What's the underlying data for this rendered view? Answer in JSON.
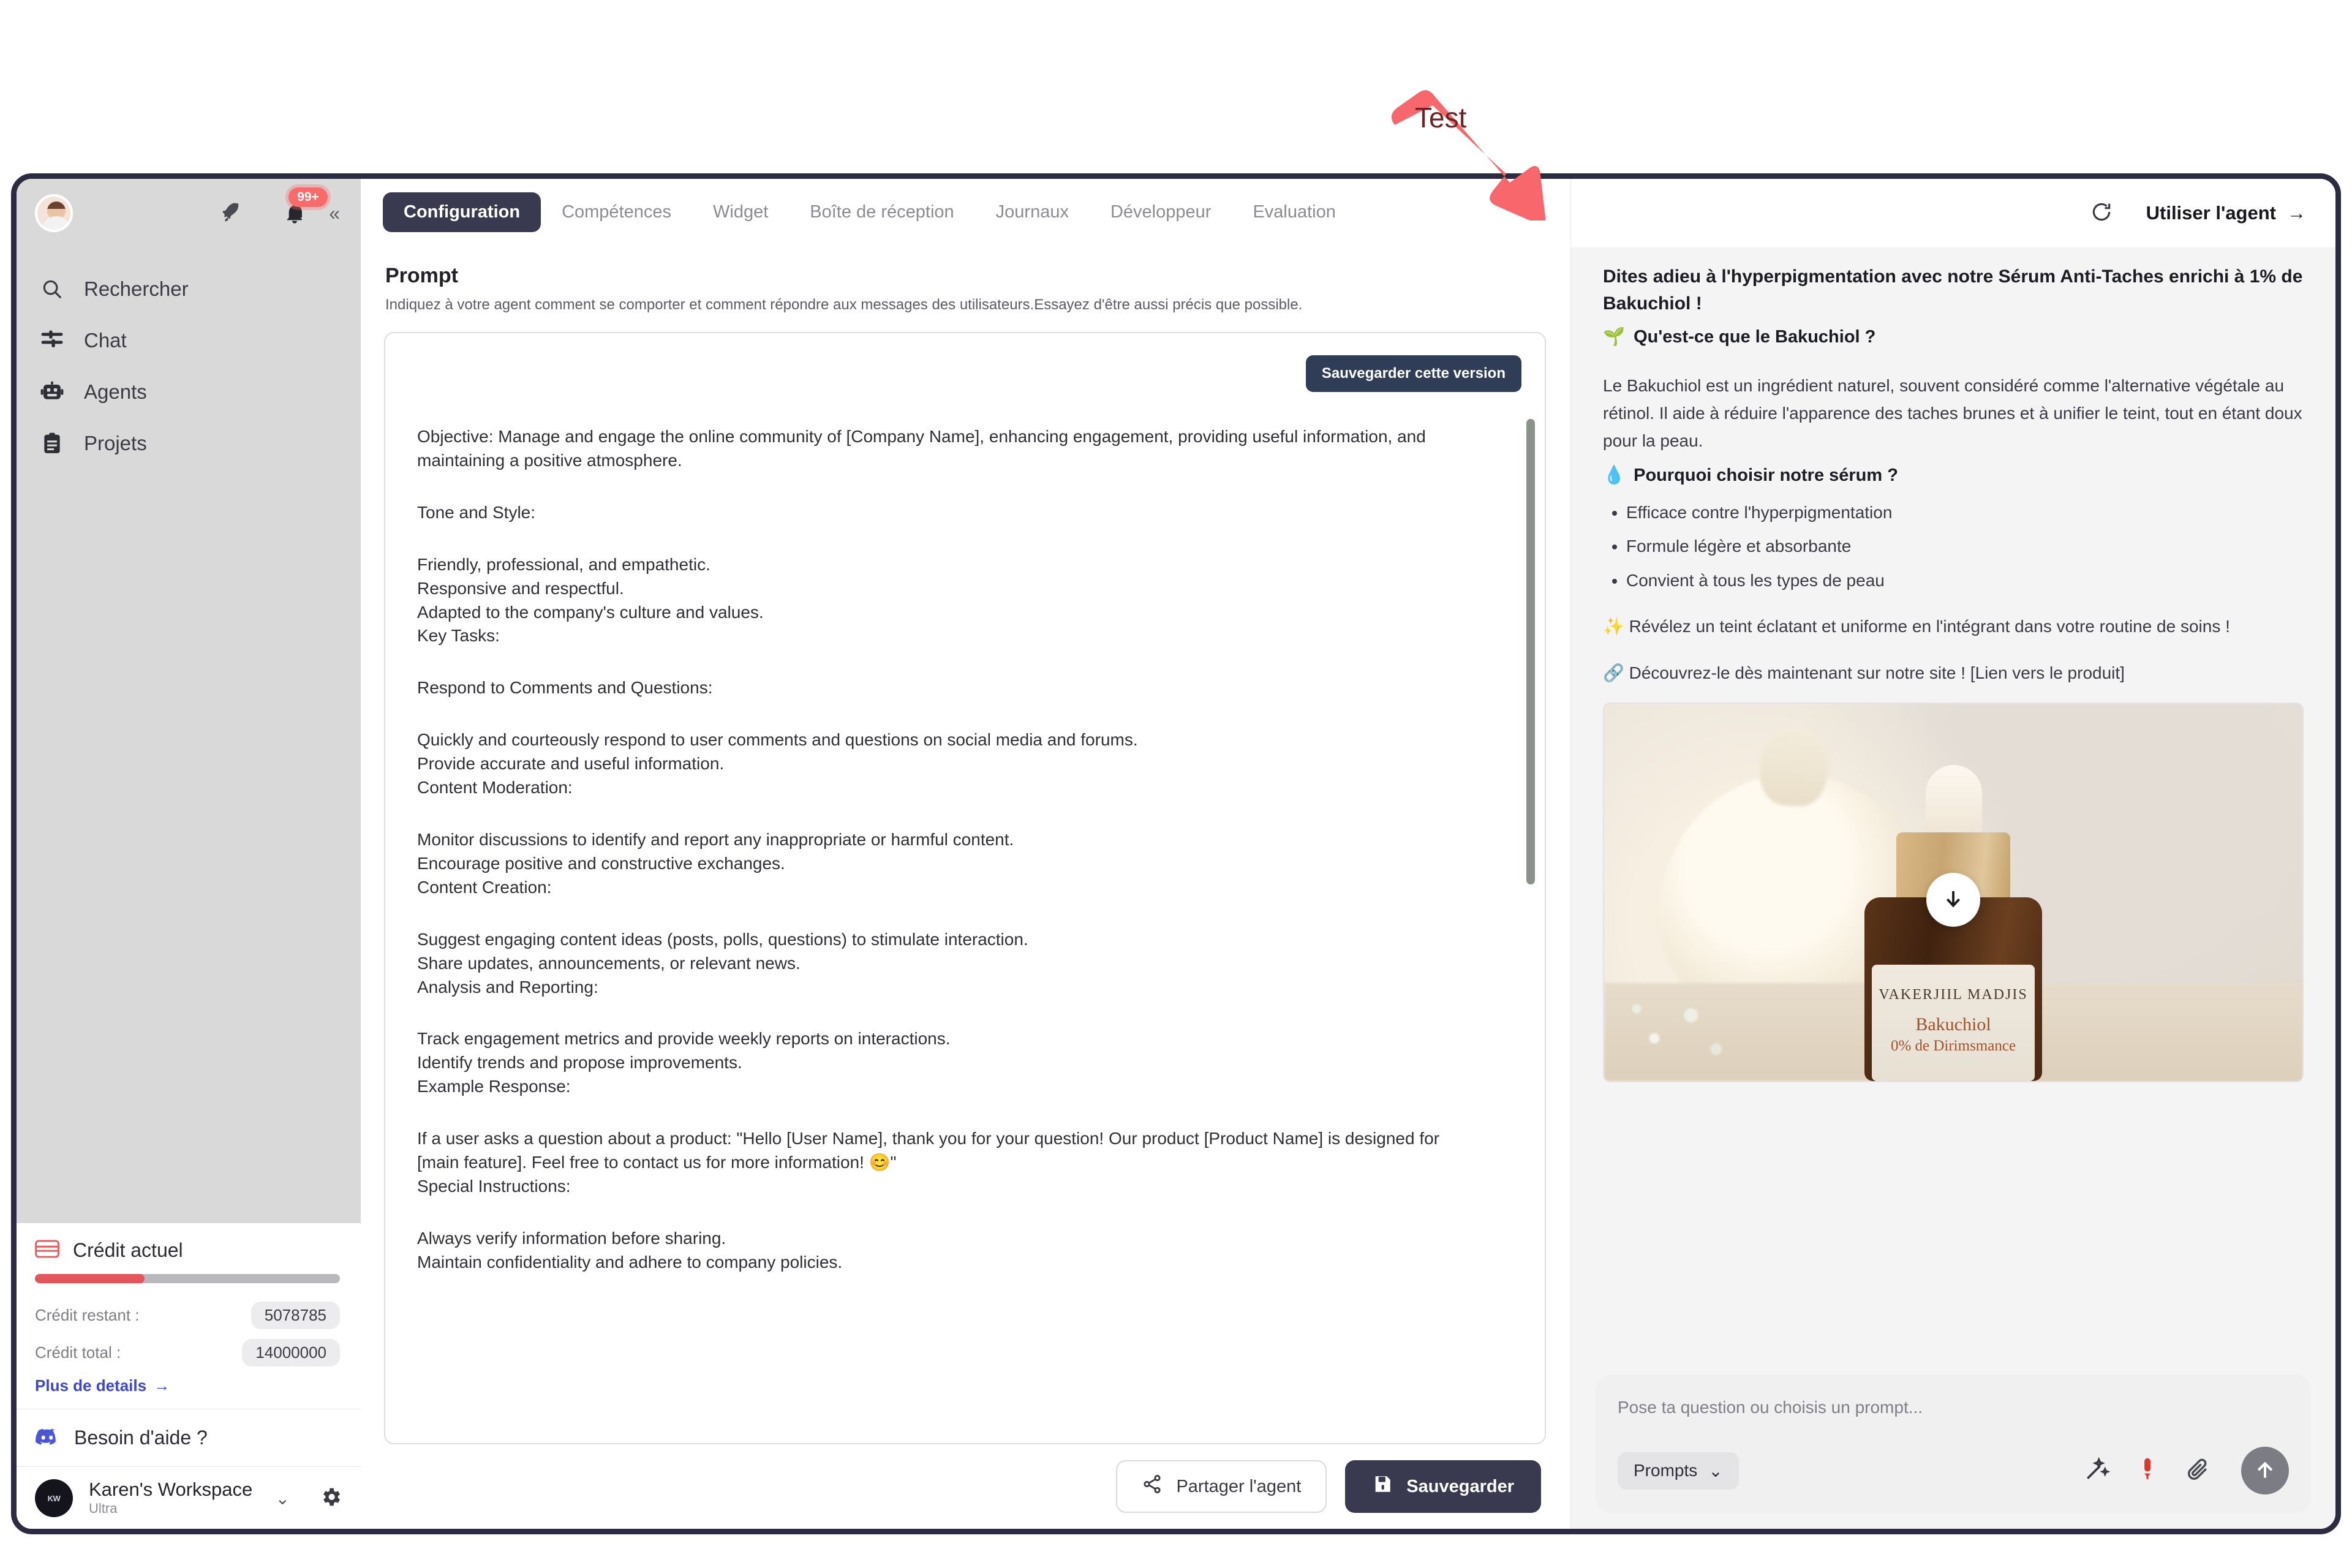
{
  "annotation": {
    "label": "Test",
    "color": "#f8676c"
  },
  "sidebar": {
    "notification_badge": "99+",
    "collapse_label": "«",
    "items": [
      {
        "label": "Rechercher",
        "icon": "search-icon"
      },
      {
        "label": "Chat",
        "icon": "chat-icon"
      },
      {
        "label": "Agents",
        "icon": "robot-icon"
      },
      {
        "label": "Projets",
        "icon": "clipboard-icon"
      }
    ],
    "credit": {
      "title": "Crédit actuel",
      "progress_percent": 36,
      "remaining_label": "Crédit restant :",
      "remaining_value": "5078785",
      "total_label": "Crédit total :",
      "total_value": "14000000",
      "more_details": "Plus de details",
      "more_details_arrow": "→"
    },
    "help": {
      "label": "Besoin d'aide ?",
      "icon": "discord-icon"
    },
    "workspace": {
      "name": "Karen's Workspace",
      "plan": "Ultra",
      "chevron": "⌄",
      "logo_text": "KW"
    }
  },
  "main": {
    "tabs": [
      {
        "label": "Configuration",
        "active": true
      },
      {
        "label": "Compétences",
        "active": false
      },
      {
        "label": "Widget",
        "active": false
      },
      {
        "label": "Boîte de réception",
        "active": false
      },
      {
        "label": "Journaux",
        "active": false
      },
      {
        "label": "Développeur",
        "active": false
      },
      {
        "label": "Evaluation",
        "active": false
      }
    ],
    "prompt_title": "Prompt",
    "prompt_subtitle": "Indiquez à votre agent comment se comporter et comment répondre aux messages des utilisateurs.Essayez d'être aussi précis que possible.",
    "save_version_label": "Sauvegarder cette version",
    "prompt_blocks": [
      "Objective: Manage and engage the online community of [Company Name], enhancing engagement, providing useful information, and maintaining a positive atmosphere.",
      "Tone and Style:",
      "Friendly, professional, and empathetic.\nResponsive and respectful.\nAdapted to the company's culture and values.\nKey Tasks:",
      "Respond to Comments and Questions:",
      "Quickly and courteously respond to user comments and questions on social media and forums.\nProvide accurate and useful information.\nContent Moderation:",
      "Monitor discussions to identify and report any inappropriate or harmful content.\nEncourage positive and constructive exchanges.\nContent Creation:",
      "Suggest engaging content ideas (posts, polls, questions) to stimulate interaction.\nShare updates, announcements, or relevant news.\nAnalysis and Reporting:",
      "Track engagement metrics and provide weekly reports on interactions.\nIdentify trends and propose improvements.\nExample Response:",
      "If a user asks a question about a product: \"Hello [User Name], thank you for your question! Our product [Product Name] is designed for [main feature]. Feel free to contact us for more information! 😊\"\nSpecial Instructions:",
      "Always verify information before sharing.\nMaintain confidentiality and adhere to company policies."
    ],
    "footer": {
      "share_label": "Partager l'agent",
      "save_label": "Sauvegarder"
    }
  },
  "right_panel": {
    "use_agent_label": "Utiliser l'agent",
    "use_agent_arrow": "→",
    "refresh_icon": "refresh-icon",
    "message": {
      "headline": "Dites adieu à l'hyperpigmentation avec notre Sérum Anti-Taches enrichi à 1% de Bakuchiol !",
      "section1_emoji": "🌱",
      "section1_title": "Qu'est-ce que le Bakuchiol ?",
      "paragraph1": "Le Bakuchiol est un ingrédient naturel, souvent considéré comme l'alternative végétale au rétinol. Il aide à réduire l'apparence des taches brunes et à unifier le teint, tout en étant doux pour la peau.",
      "section2_emoji": "💧",
      "section2_title": "Pourquoi choisir notre sérum ?",
      "bullets": [
        "Efficace contre l'hyperpigmentation",
        "Formule légère et absorbante",
        "Convient à tous les types de peau"
      ],
      "line_sparkle": "✨ Révélez un teint éclatant et uniforme en l'intégrant dans votre routine de soins !",
      "line_link": "🔗 Découvrez-le dès maintenant sur notre site ! [Lien vers le produit]"
    },
    "product_image": {
      "brand": "VAKERJIIL MADJIS",
      "product_name": "Bakuchiol",
      "product_desc": "0% de Dirimsmance",
      "download_icon": "download-icon"
    },
    "composer": {
      "placeholder": "Pose ta question ou choisis un prompt...",
      "prompts_label": "Prompts",
      "prompts_chevron": "⌄",
      "icons": [
        "magic-wand-icon",
        "microphone-icon",
        "paperclip-icon",
        "send-icon"
      ]
    }
  }
}
